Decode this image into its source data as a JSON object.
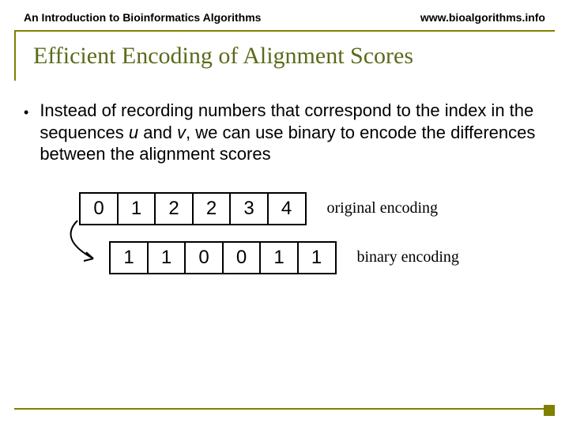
{
  "header": {
    "left": "An Introduction to Bioinformatics Algorithms",
    "right": "www.bioalgorithms.info"
  },
  "title": "Efficient Encoding of Alignment Scores",
  "bullet": "•",
  "body": {
    "t1": "Instead of recording numbers that correspond to the index in the sequences ",
    "u": "u",
    "t2": " and ",
    "v": "v",
    "t3": ", we can use binary to encode the differences between the alignment scores"
  },
  "rows": {
    "original": {
      "cells": [
        "0",
        "1",
        "2",
        "2",
        "3",
        "4"
      ],
      "label": "original encoding"
    },
    "binary": {
      "cells": [
        "1",
        "1",
        "0",
        "0",
        "1",
        "1"
      ],
      "label": "binary encoding"
    }
  }
}
